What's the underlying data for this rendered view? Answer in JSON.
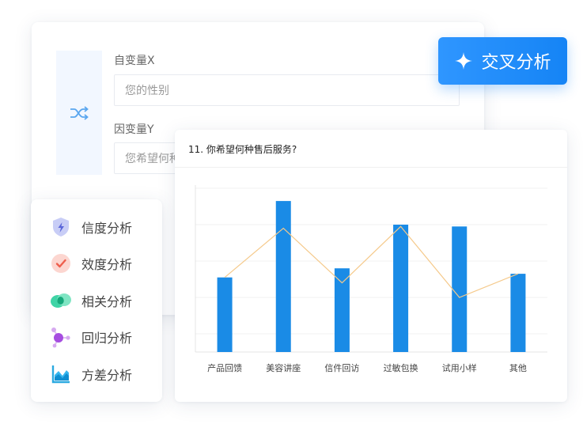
{
  "variables": {
    "x_label": "自变量X",
    "x_placeholder": "您的性别",
    "y_label": "因变量Y",
    "y_placeholder": "您希望何种",
    "swap_icon": "shuffle-icon"
  },
  "cross_button": {
    "label": "交叉分析",
    "icon": "sparkle-icon",
    "color": "#1584f5"
  },
  "menu": {
    "items": [
      {
        "label": "信度分析",
        "icon": "shield-bolt-icon"
      },
      {
        "label": "效度分析",
        "icon": "checkmark-icon"
      },
      {
        "label": "相关分析",
        "icon": "chat-bubbles-icon"
      },
      {
        "label": "回归分析",
        "icon": "molecule-icon"
      },
      {
        "label": "方差分析",
        "icon": "area-chart-icon"
      }
    ]
  },
  "chart_data": {
    "type": "bar",
    "title": "11. 你希望何种售后服务?",
    "categories": [
      "产品回馈",
      "美容讲座",
      "信件回访",
      "过敏包换",
      "试用小样",
      "其他"
    ],
    "series": [
      {
        "type": "bar",
        "values": [
          41,
          83,
          46,
          70,
          69,
          43
        ]
      },
      {
        "type": "line",
        "values": [
          41,
          68,
          38,
          69,
          30,
          43
        ]
      }
    ],
    "ylim": [
      0,
      90
    ],
    "grid": true,
    "bar_color": "#1a8be6",
    "line_color": "#f5c98a"
  }
}
